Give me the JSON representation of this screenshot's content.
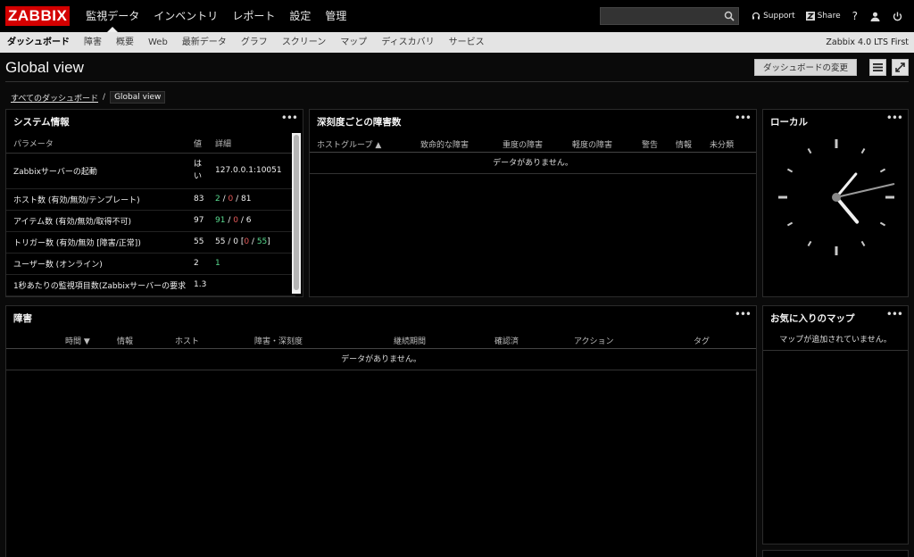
{
  "app": {
    "logo": "ZABBIX",
    "menu": [
      "監視データ",
      "インベントリ",
      "レポート",
      "設定",
      "管理"
    ],
    "search": {
      "value": "",
      "placeholder": ""
    },
    "support": "Support",
    "share": "Share",
    "help": "?"
  },
  "subnav": {
    "items": [
      "ダッシュボード",
      "障害",
      "概要",
      "Web",
      "最新データ",
      "グラフ",
      "スクリーン",
      "マップ",
      "ディスカバリ",
      "サービス"
    ],
    "version": "Zabbix 4.0 LTS First"
  },
  "page": {
    "title": "Global view",
    "edit_button": "ダッシュボードの変更",
    "breadcrumb_parent": "すべてのダッシュボード",
    "breadcrumb_sep": "/",
    "breadcrumb_current": "Global view"
  },
  "system_info": {
    "title": "システム情報",
    "headers": [
      "パラメータ",
      "値",
      "詳細"
    ],
    "rows": [
      {
        "param": "Zabbixサーバーの起動",
        "value": "はい",
        "detail": "127.0.0.1:10051"
      },
      {
        "param": "ホスト数 (有効/無効/テンプレート)",
        "value": "83",
        "d1": "2",
        "d2": "0",
        "d3": "81"
      },
      {
        "param": "アイテム数 (有効/無効/取得不可)",
        "value": "97",
        "d1": "91",
        "d2": "0",
        "d3": "6"
      },
      {
        "param": "トリガー数 (有効/無効 [障害/正常])",
        "value": "55",
        "d1": "55",
        "d2": "0",
        "d3": "0",
        "d4": "55"
      },
      {
        "param": "ユーザー数 (オンライン)",
        "value": "2",
        "d1": "1"
      },
      {
        "param": "1秒あたりの監視項目数(Zabbixサーバーの要求",
        "value": "1.3"
      }
    ]
  },
  "severity": {
    "title": "深刻度ごとの障害数",
    "headers": [
      "ホストグループ ▲",
      "致命的な障害",
      "重度の障害",
      "軽度の障害",
      "警告",
      "情報",
      "未分類"
    ],
    "empty": "データがありません。"
  },
  "clock": {
    "title": "ローカル",
    "hour_angle": 140,
    "minute_angle": 40,
    "second_angle": 77
  },
  "problems": {
    "title": "障害",
    "headers": [
      "時間 ▼",
      "情報",
      "ホスト",
      "障害・深刻度",
      "継続期間",
      "確認済",
      "アクション",
      "タグ"
    ],
    "empty": "データがありません。"
  },
  "fav_maps": {
    "title": "お気に入りのマップ",
    "empty": "マップが追加されていません。"
  },
  "widget_menu": "•••"
}
